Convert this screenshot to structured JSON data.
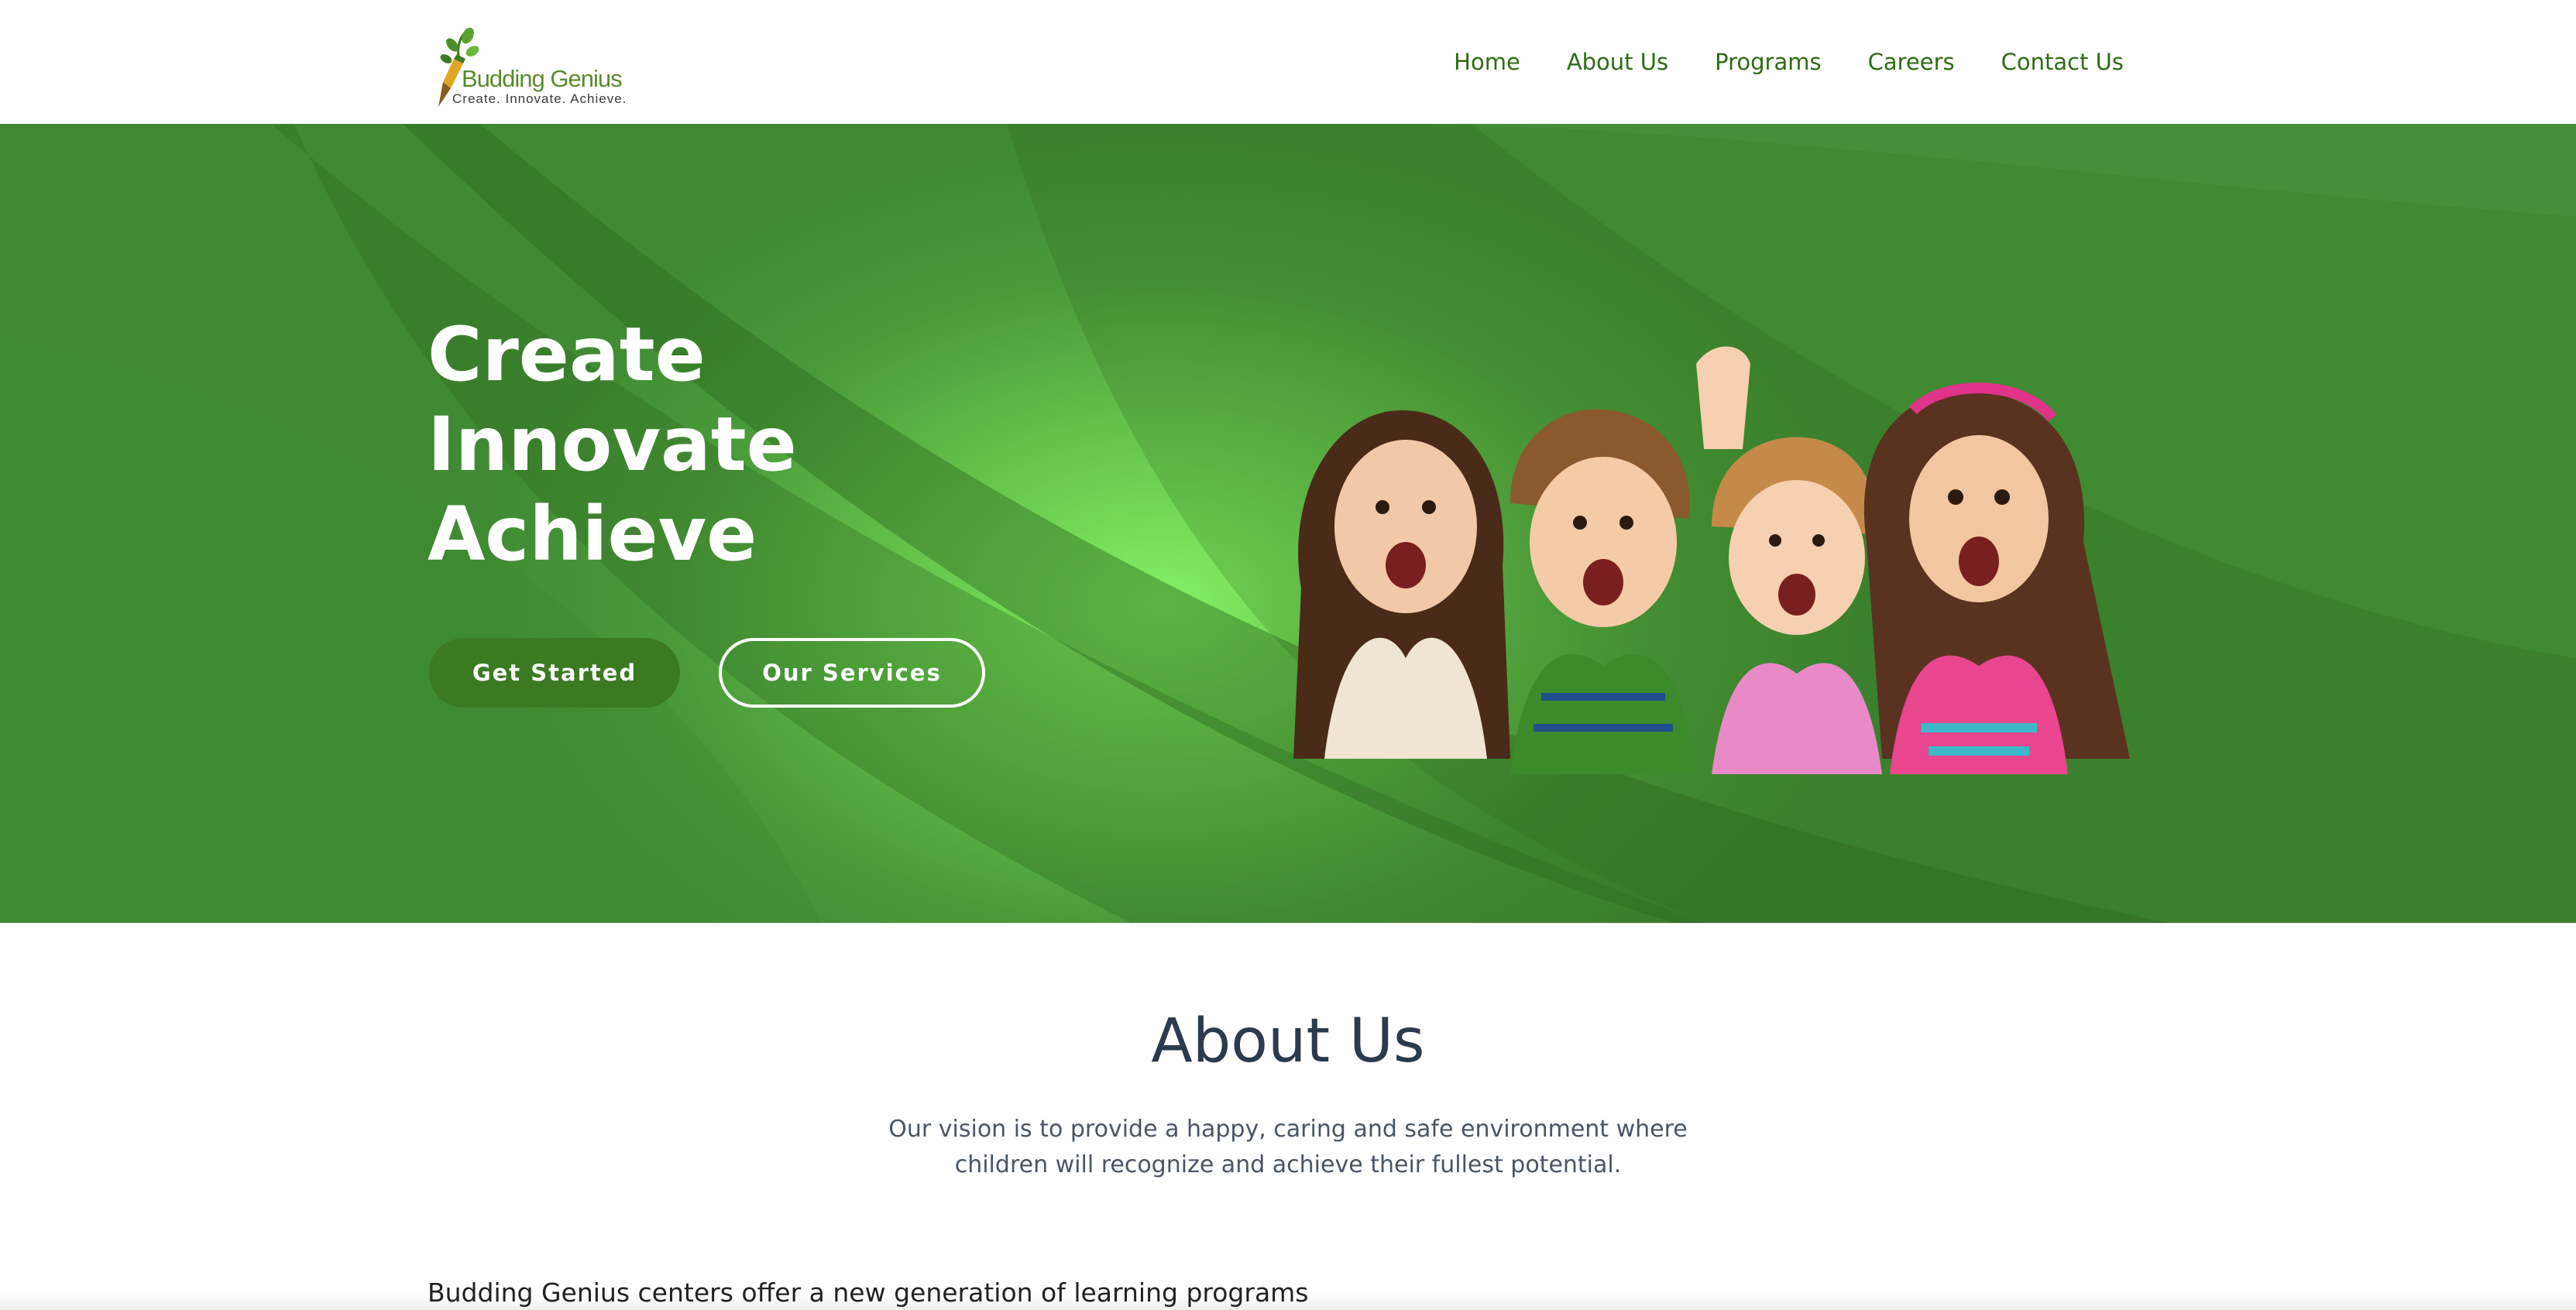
{
  "header": {
    "logo": {
      "name": "Budding Genius",
      "tagline": "Create. Innovate. Achieve."
    },
    "nav": [
      {
        "label": "Home"
      },
      {
        "label": "About Us"
      },
      {
        "label": "Programs"
      },
      {
        "label": "Careers"
      },
      {
        "label": "Contact Us"
      }
    ]
  },
  "hero": {
    "title_lines": [
      "Create",
      "Innovate",
      "Achieve"
    ],
    "primary_button": "Get Started",
    "secondary_button": "Our Services",
    "image": "four children lying down with hands on cheeks, smiling"
  },
  "about": {
    "title": "About Us",
    "text": "Our vision is to provide a happy, caring and safe environment where children will recognize and achieve their fullest potential.",
    "intro": "Budding Genius centers offer a new generation of learning programs"
  },
  "colors": {
    "nav_text": "#2f6b16",
    "hero_green": "#4a9a3a",
    "button_primary": "#3b7a21",
    "heading": "#2b3a4d"
  }
}
